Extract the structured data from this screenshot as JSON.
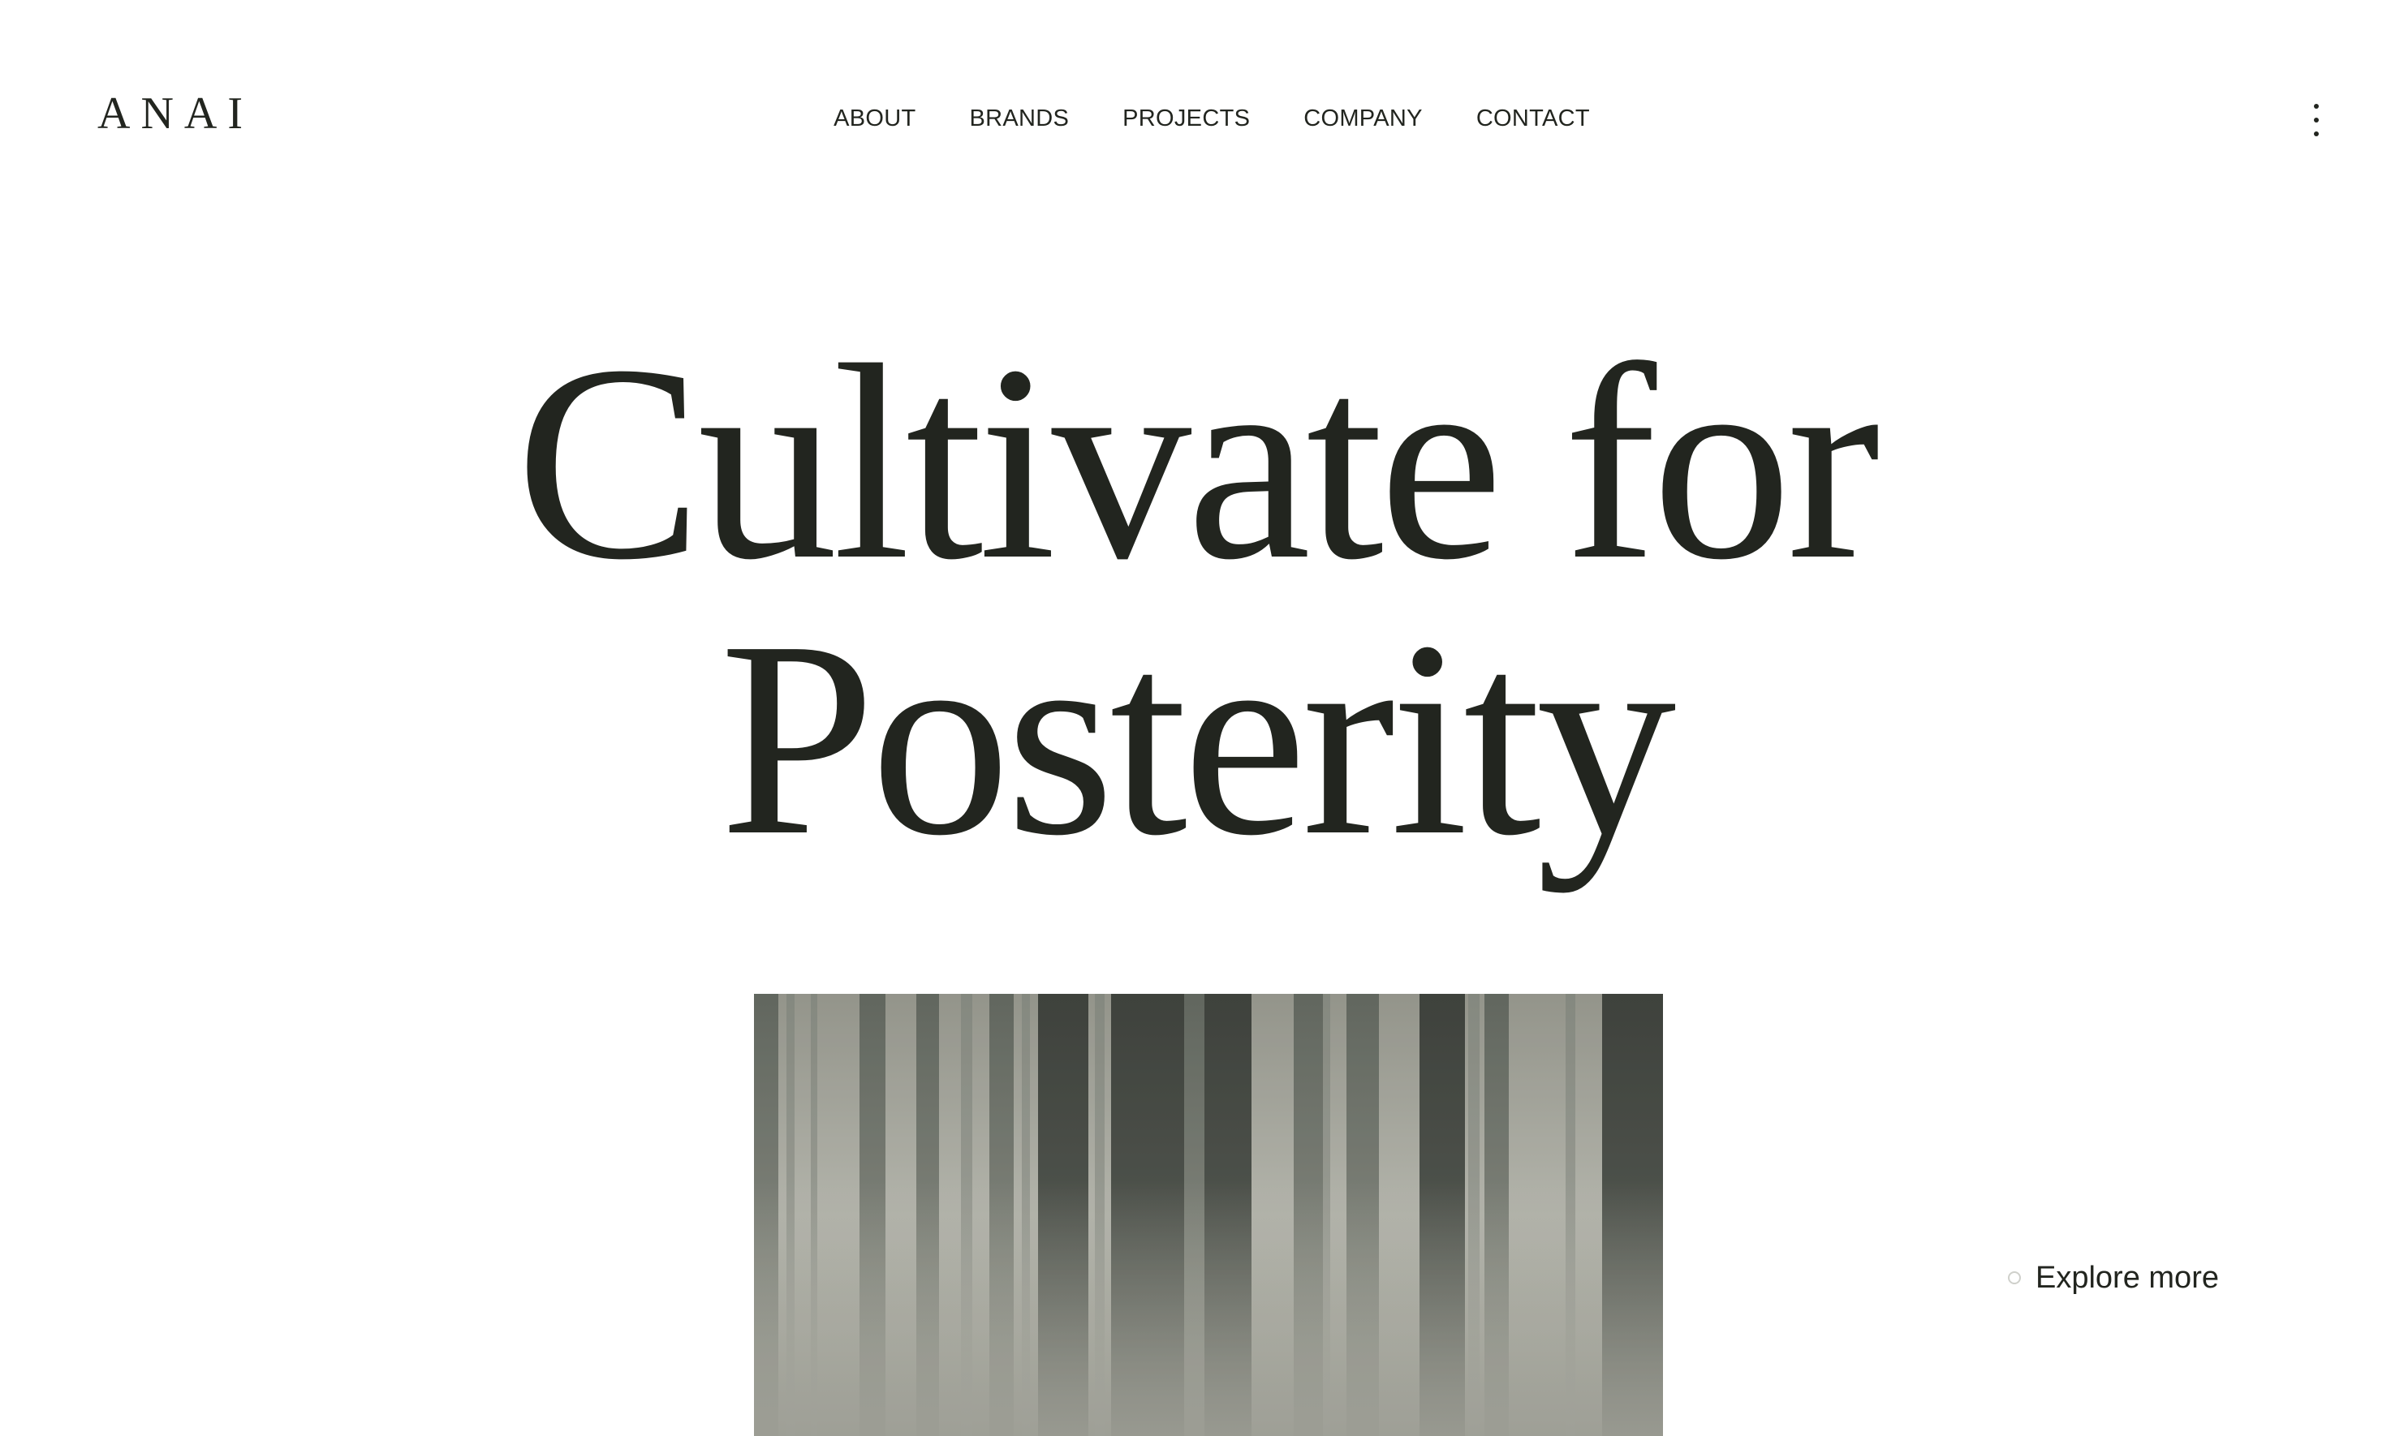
{
  "brand": {
    "logo_text": "ANAI"
  },
  "nav": {
    "items": [
      {
        "label": "ABOUT"
      },
      {
        "label": "BRANDS"
      },
      {
        "label": "PROJECTS"
      },
      {
        "label": "COMPANY"
      },
      {
        "label": "CONTACT"
      }
    ]
  },
  "menu": {
    "icon": "kebab-menu-icon"
  },
  "hero": {
    "line1": "Cultivate for",
    "line2": "Posterity"
  },
  "photo": {
    "subject": "forest-trees-image"
  },
  "explore": {
    "label": "Explore more",
    "icon": "circle-icon"
  },
  "colors": {
    "text": "#22251f",
    "background": "#ffffff",
    "muted_circle": "#cfd0cb"
  }
}
